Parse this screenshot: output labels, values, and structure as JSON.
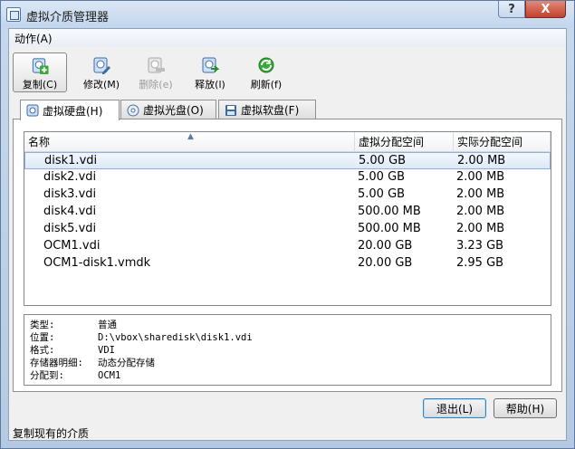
{
  "window": {
    "title": "虚拟介质管理器",
    "help_btn": "?",
    "close_btn": "X"
  },
  "menu": {
    "actions": "动作(A)"
  },
  "toolbar": {
    "copy": "复制(C)",
    "modify": "修改(M)",
    "remove": "删除(e)",
    "release": "释放(l)",
    "refresh": "刷新(f)"
  },
  "tabs": {
    "hard_disks": "虚拟硬盘(H)",
    "optical": "虚拟光盘(O)",
    "floppy": "虚拟软盘(F)"
  },
  "list": {
    "columns": {
      "name": "名称",
      "virtual_size": "虚拟分配空间",
      "actual_size": "实际分配空间"
    },
    "rows": [
      {
        "name": "disk1.vdi",
        "virtual_size": "5.00 GB",
        "actual_size": "2.00 MB"
      },
      {
        "name": "disk2.vdi",
        "virtual_size": "5.00 GB",
        "actual_size": "2.00 MB"
      },
      {
        "name": "disk3.vdi",
        "virtual_size": "5.00 GB",
        "actual_size": "2.00 MB"
      },
      {
        "name": "disk4.vdi",
        "virtual_size": "500.00 MB",
        "actual_size": "2.00 MB"
      },
      {
        "name": "disk5.vdi",
        "virtual_size": "500.00 MB",
        "actual_size": "2.00 MB"
      },
      {
        "name": "OCM1.vdi",
        "virtual_size": "20.00 GB",
        "actual_size": "3.23 GB"
      },
      {
        "name": "OCM1-disk1.vmdk",
        "virtual_size": "20.00 GB",
        "actual_size": "2.95 GB"
      }
    ],
    "selected_index": 0
  },
  "details": {
    "type_label": "类型:",
    "type_value": "普通",
    "location_label": "位置:",
    "location_value": "D:\\vbox\\sharedisk\\disk1.vdi",
    "format_label": "格式:",
    "format_value": "VDI",
    "storage_label": "存储器明细:",
    "storage_value": "动态分配存储",
    "attached_label": "分配到:",
    "attached_value": "OCM1"
  },
  "buttons": {
    "exit": "退出(L)",
    "help": "帮助(H)"
  },
  "status_text": "复制现有的介质",
  "icons": {
    "copy": "copy-disk-icon",
    "modify": "modify-disk-icon",
    "remove": "remove-disk-icon",
    "release": "release-disk-icon",
    "refresh": "refresh-icon"
  },
  "colors": {
    "selection": "#dde9f7",
    "refresh_green": "#3aa93a",
    "accent_blue": "#2f62a6"
  }
}
